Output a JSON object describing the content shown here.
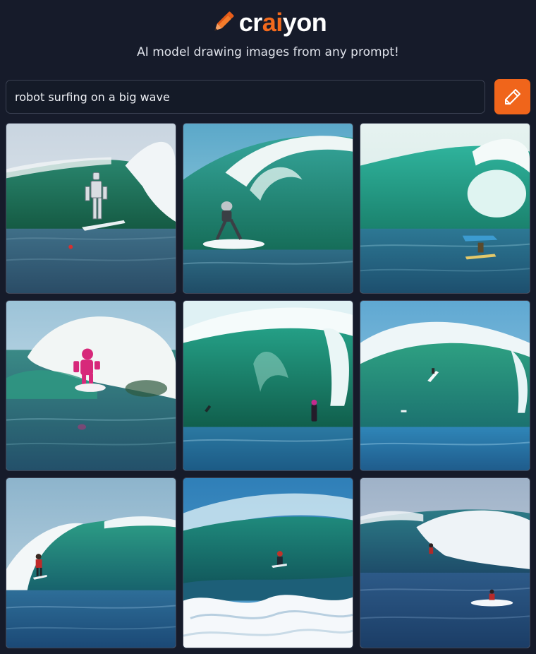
{
  "app": {
    "logo_icon": "pencil-icon",
    "logo_text_before": "cr",
    "logo_text_accent": "ai",
    "logo_text_after": "yon",
    "tagline": "AI model drawing images from any prompt!",
    "accent_color": "#f0651b"
  },
  "prompt": {
    "value": "robot surfing on a big wave",
    "button_icon": "pencil-icon"
  },
  "results": {
    "count": 9,
    "images": [
      {
        "variant": "robot-surfer-wave-left"
      },
      {
        "variant": "robot-surfer-barrel-center"
      },
      {
        "variant": "robot-surfer-small-right"
      },
      {
        "variant": "pink-robot-whitewater"
      },
      {
        "variant": "dark-green-barrel"
      },
      {
        "variant": "surfer-blue-barrel"
      },
      {
        "variant": "surfer-wave-left"
      },
      {
        "variant": "deep-blue-barrel-foam"
      },
      {
        "variant": "surfer-whitewater-board"
      }
    ]
  }
}
